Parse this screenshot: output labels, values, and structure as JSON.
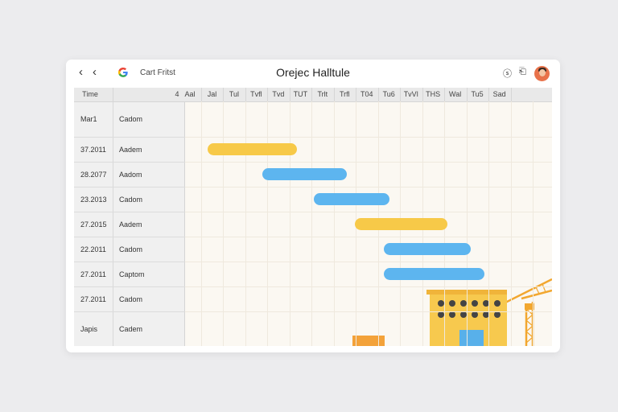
{
  "toolbar": {
    "back": "‹",
    "forward": "‹",
    "brand": "Cart Fritst",
    "title": "Orejec Halltule",
    "icon_a": "ⓢ",
    "icon_b": "⎗"
  },
  "columns": [
    "Time",
    "4",
    "Aal",
    "Jal",
    "Tul",
    "Tvfl",
    "Tvd",
    "TUT",
    "Trlt",
    "Trfl",
    "T04",
    "Tu6",
    "TvVl",
    "THS",
    "Wal",
    "Tu5",
    "Sad"
  ],
  "rows": [
    {
      "date": "Mar1",
      "name": "Cadom"
    },
    {
      "date": "37.2011",
      "name": "Aadem"
    },
    {
      "date": "28.2077",
      "name": "Aadom"
    },
    {
      "date": "23.2013",
      "name": "Cadom"
    },
    {
      "date": "27.2015",
      "name": "Aadem"
    },
    {
      "date": "22.2011",
      "name": "Cadom"
    },
    {
      "date": "27.2011",
      "name": "Captom"
    },
    {
      "date": "27.2011",
      "name": "Cadom"
    },
    {
      "date": "Japis",
      "name": "Cadem"
    }
  ],
  "bars": [
    {
      "row": 1,
      "start_col": 0.6,
      "span": 4.6,
      "color": "yellow"
    },
    {
      "row": 2,
      "start_col": 3.4,
      "span": 4.4,
      "color": "blue"
    },
    {
      "row": 3,
      "start_col": 6.1,
      "span": 3.9,
      "color": "blue"
    },
    {
      "row": 4,
      "start_col": 8.2,
      "span": 4.8,
      "color": "yellow"
    },
    {
      "row": 5,
      "start_col": 9.7,
      "span": 4.5,
      "color": "blue"
    },
    {
      "row": 6,
      "start_col": 9.7,
      "span": 5.2,
      "color": "blue"
    }
  ],
  "colors": {
    "yellow": "#f7c948",
    "blue": "#5db5ef",
    "crane": "#f2a72f"
  },
  "icons": [
    "back-icon",
    "forward-icon",
    "google-logo-icon",
    "share-icon",
    "save-icon",
    "avatar-icon",
    "crane-illustration",
    "building-illustration"
  ]
}
